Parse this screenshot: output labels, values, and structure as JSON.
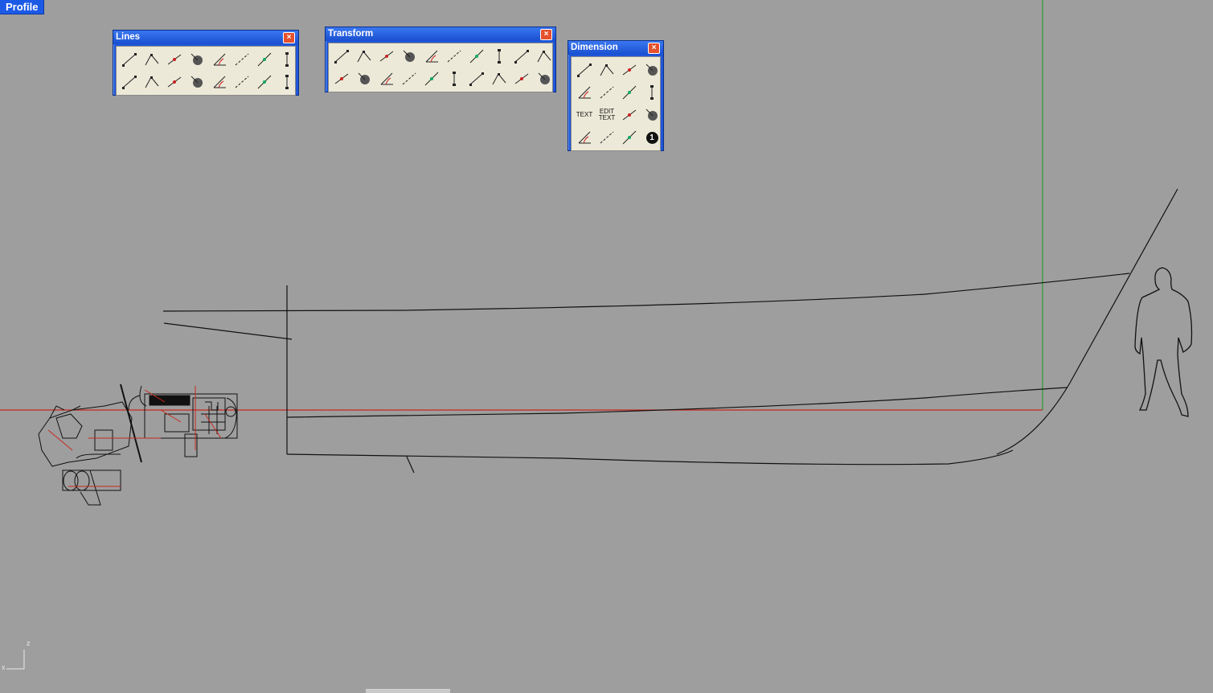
{
  "viewport": {
    "label": "Profile",
    "axis_labels": {
      "z": "z",
      "x": "x"
    }
  },
  "palettes": {
    "lines": {
      "title": "Lines",
      "tools": [
        {
          "icon": "line-icon"
        },
        {
          "icon": "polyline-icon"
        },
        {
          "icon": "line-from-midpoint-icon"
        },
        {
          "icon": "line-normal-to-surface-icon"
        },
        {
          "icon": "line-angled-icon"
        },
        {
          "icon": "line-perpendicular-icon"
        },
        {
          "icon": "line-tangent-icon"
        },
        {
          "icon": "line-vertical-icon"
        },
        {
          "icon": "line-horizontal-icon"
        },
        {
          "icon": "line-short-icon"
        },
        {
          "icon": "line-bisector-icon"
        },
        {
          "icon": "line-dotted-icon"
        },
        {
          "icon": "line-extend-icon"
        },
        {
          "icon": "line-corner-icon"
        },
        {
          "icon": "line-chevron-icon"
        },
        {
          "icon": "line-fit-points-icon"
        }
      ]
    },
    "transform": {
      "title": "Transform",
      "tools": [
        {
          "icon": "move-icon"
        },
        {
          "icon": "copy-icon"
        },
        {
          "icon": "rotate-icon"
        },
        {
          "icon": "scale-icon"
        },
        {
          "icon": "mirror-icon"
        },
        {
          "icon": "orient-icon"
        },
        {
          "icon": "project-icon"
        },
        {
          "icon": "twist-icon"
        },
        {
          "icon": "set-points-icon"
        },
        {
          "icon": "bend-icon"
        },
        {
          "icon": "array-icon"
        },
        {
          "icon": "polar-array-icon"
        },
        {
          "icon": "align-icon"
        },
        {
          "icon": "array-curve-icon"
        },
        {
          "icon": "stretch-icon"
        },
        {
          "icon": "flow-icon"
        },
        {
          "icon": "taper-icon"
        },
        {
          "icon": "shear-icon"
        },
        {
          "icon": "smash-icon"
        },
        {
          "icon": "wave-icon"
        }
      ]
    },
    "dimension": {
      "title": "Dimension",
      "tools": [
        {
          "icon": "linear-dimension-icon"
        },
        {
          "icon": "aligned-dimension-icon"
        },
        {
          "icon": "rotated-dimension-icon"
        },
        {
          "icon": "angle-dimension-icon"
        },
        {
          "icon": "radius-dimension-icon"
        },
        {
          "icon": "ordinate-dimension-icon"
        },
        {
          "icon": "radial-r-icon"
        },
        {
          "icon": "diameter-icon"
        },
        {
          "icon": "text-icon",
          "label": "TEXT"
        },
        {
          "icon": "edit-text-icon",
          "label": "EDIT TEXT"
        },
        {
          "icon": "leader-icon"
        },
        {
          "icon": "dimension-arrow-icon"
        },
        {
          "icon": "leader-arrow-icon"
        },
        {
          "icon": "hatch-icon"
        },
        {
          "icon": "pencil-icon"
        },
        {
          "icon": "numbered-balloon-icon",
          "label": "1"
        }
      ]
    }
  }
}
